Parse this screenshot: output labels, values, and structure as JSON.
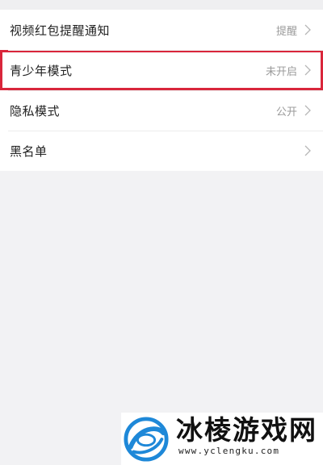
{
  "settings": {
    "items": [
      {
        "label": "视频红包提醒通知",
        "value": "提醒",
        "icon": "chevron-right-icon"
      },
      {
        "label": "青少年模式",
        "value": "未开启",
        "icon": "chevron-right-icon"
      },
      {
        "label": "隐私模式",
        "value": "公开",
        "icon": "chevron-right-icon"
      },
      {
        "label": "黑名单",
        "value": "",
        "icon": "chevron-right-icon"
      }
    ]
  },
  "watermark": {
    "title": "冰棱游戏网",
    "url": "www.yclengku.com",
    "logo_icon": "swirl-logo-icon"
  },
  "colors": {
    "highlight_border": "#d9263b",
    "background": "#f2f2f4",
    "logo_blue": "#1e88d8"
  }
}
